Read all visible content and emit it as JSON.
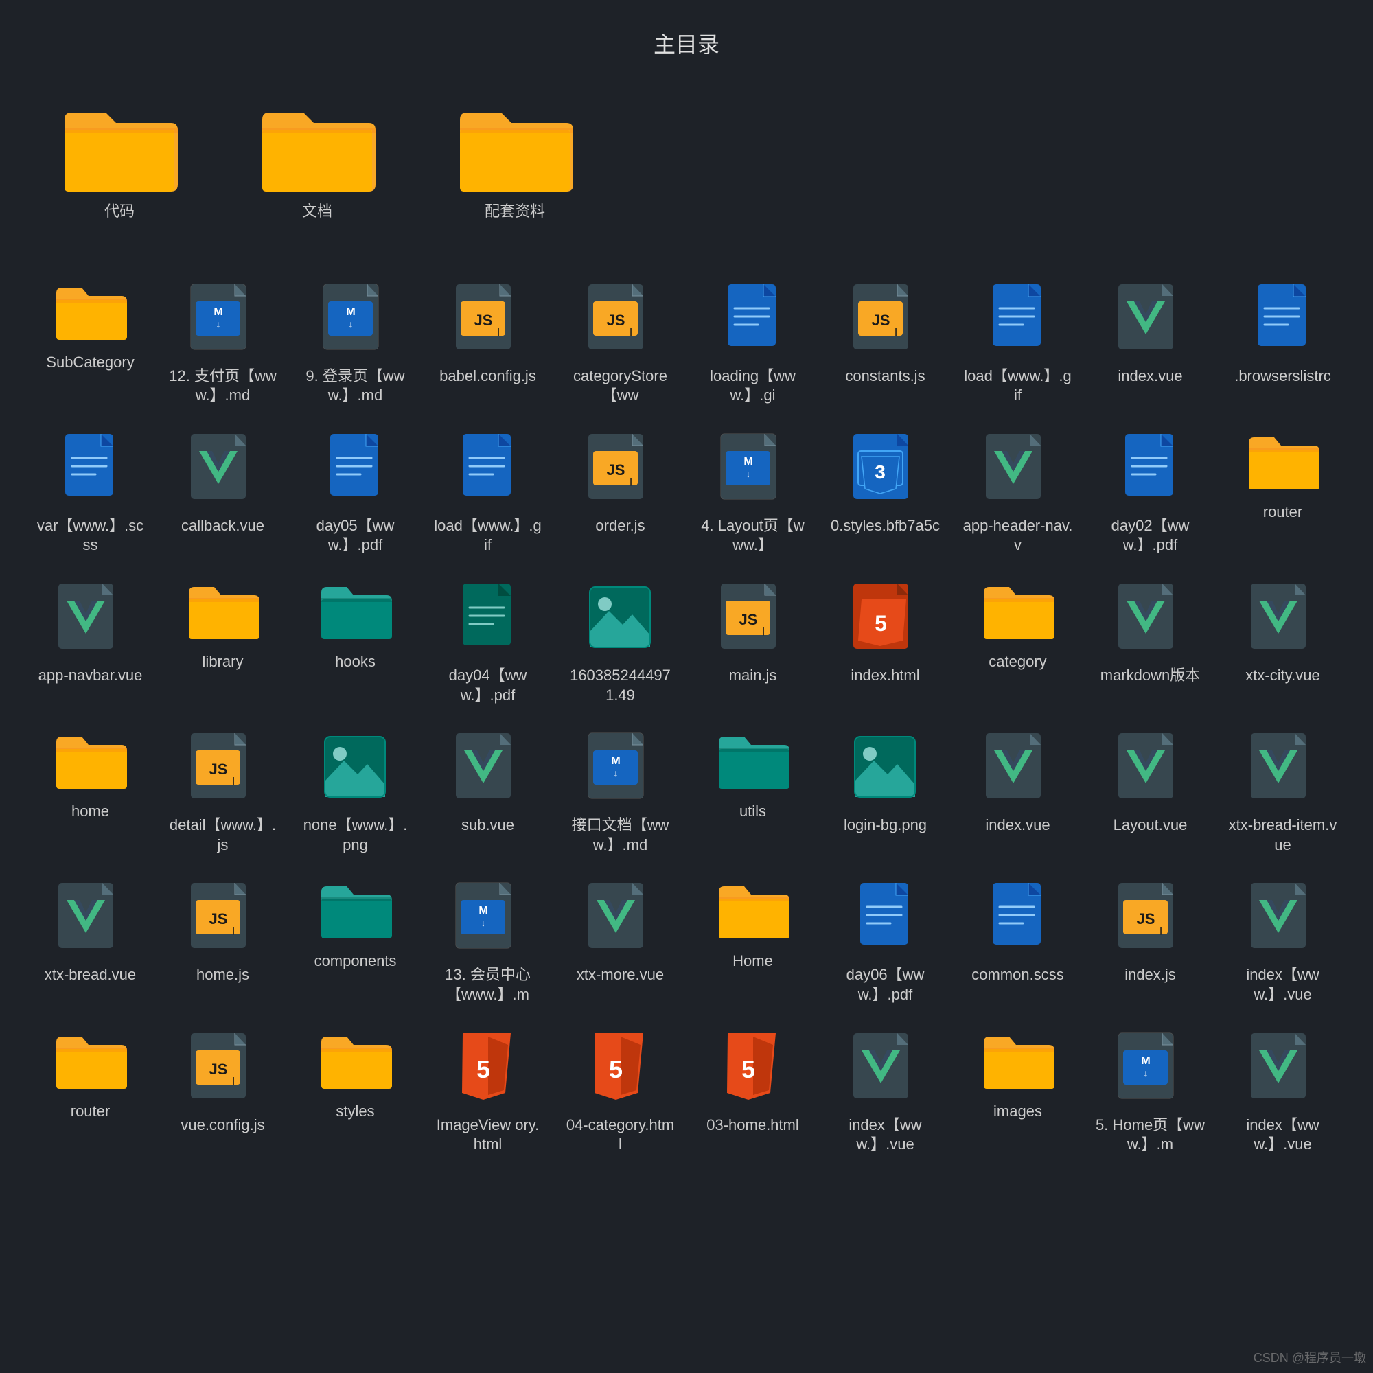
{
  "title": "主目录",
  "watermark": "CSDN @程序员一墩",
  "topFolders": [
    {
      "id": "daima",
      "label": "代码",
      "color": "yellow"
    },
    {
      "id": "wendang",
      "label": "文档",
      "color": "yellow"
    },
    {
      "id": "peitao",
      "label": "配套资料",
      "color": "yellow"
    }
  ],
  "items": [
    {
      "id": "subcategory",
      "type": "folder-yellow",
      "label": "SubCategory"
    },
    {
      "id": "md-12",
      "type": "md",
      "label": "12. 支付页【www.】.md"
    },
    {
      "id": "md-9",
      "type": "md",
      "label": "9. 登录页【www.】.md"
    },
    {
      "id": "babel-js",
      "type": "js",
      "label": "babel.config.js"
    },
    {
      "id": "category-store",
      "type": "js",
      "label": "categoryStore【ww"
    },
    {
      "id": "loading-gif",
      "type": "file-blue",
      "label": "loading【www.】.gi"
    },
    {
      "id": "constants-js",
      "type": "js",
      "label": "constants.js"
    },
    {
      "id": "load-gif",
      "type": "file-blue",
      "label": "load【www.】.gif"
    },
    {
      "id": "index-vue",
      "type": "vue",
      "label": "index.vue"
    },
    {
      "id": "browserslistrc",
      "type": "file-blue",
      "label": ".browserslistrc"
    },
    {
      "id": "var-scss",
      "type": "file-blue",
      "label": "var【www.】.scss"
    },
    {
      "id": "callback-vue",
      "type": "vue",
      "label": "callback.vue"
    },
    {
      "id": "day05-pdf",
      "type": "file-blue",
      "label": "day05【www.】.pdf"
    },
    {
      "id": "load-gif2",
      "type": "file-blue",
      "label": "load【www.】.gif"
    },
    {
      "id": "order-js",
      "type": "js",
      "label": "order.js"
    },
    {
      "id": "layout-md",
      "type": "md",
      "label": "4. Layout页【www.】"
    },
    {
      "id": "styles-css",
      "type": "css",
      "label": "0.styles.bfb7a5c"
    },
    {
      "id": "app-header-vue",
      "type": "vue",
      "label": "app-header-nav.v"
    },
    {
      "id": "day02-pdf",
      "type": "file-blue",
      "label": "day02【ww w.】.pdf"
    },
    {
      "id": "router",
      "type": "folder-yellow",
      "label": "router"
    },
    {
      "id": "app-navbar-vue",
      "type": "vue",
      "label": "app-navbar.vue"
    },
    {
      "id": "library",
      "type": "folder-yellow",
      "label": "library"
    },
    {
      "id": "hooks",
      "type": "folder-teal",
      "label": "hooks"
    },
    {
      "id": "day04-pdf",
      "type": "file-teal",
      "label": "day04【www.】.pdf"
    },
    {
      "id": "img-1604",
      "type": "img-teal",
      "label": "1603852444971.49"
    },
    {
      "id": "main-js",
      "type": "js",
      "label": "main.js"
    },
    {
      "id": "index-html",
      "type": "html5",
      "label": "index.html"
    },
    {
      "id": "category2",
      "type": "folder-yellow",
      "label": "category"
    },
    {
      "id": "markdown-vue",
      "type": "vue",
      "label": "markdown版本"
    },
    {
      "id": "xtx-city-vue",
      "type": "vue",
      "label": "xtx-city.vue"
    },
    {
      "id": "home",
      "type": "folder-yellow",
      "label": "home"
    },
    {
      "id": "detail-js",
      "type": "js",
      "label": "detail【www.】.js"
    },
    {
      "id": "none-png",
      "type": "img-teal",
      "label": "none【www.】.png"
    },
    {
      "id": "sub-vue",
      "type": "vue",
      "label": "sub.vue"
    },
    {
      "id": "api-md",
      "type": "md",
      "label": "接口文档【www.】.md"
    },
    {
      "id": "utils",
      "type": "folder-teal",
      "label": "utils"
    },
    {
      "id": "login-bg-png",
      "type": "img-teal",
      "label": "login-bg.png"
    },
    {
      "id": "index-vue2",
      "type": "vue",
      "label": "index.vue"
    },
    {
      "id": "layout-vue",
      "type": "vue",
      "label": "Layout.vue"
    },
    {
      "id": "xtx-bread-item-vue",
      "type": "vue",
      "label": "xtx-bread-item.vue"
    },
    {
      "id": "xtx-bread-vue",
      "type": "vue",
      "label": "xtx-bread.vue"
    },
    {
      "id": "home-js",
      "type": "js",
      "label": "home.js"
    },
    {
      "id": "components",
      "type": "folder-teal",
      "label": "components"
    },
    {
      "id": "md-13",
      "type": "md",
      "label": "13. 会员中心【www.】.m"
    },
    {
      "id": "xtx-more-vue",
      "type": "vue",
      "label": "xtx-more.vue"
    },
    {
      "id": "home-folder",
      "type": "folder-yellow",
      "label": "Home"
    },
    {
      "id": "day06-pdf",
      "type": "file-blue",
      "label": "day06【ww w.】.pdf"
    },
    {
      "id": "common-css",
      "type": "file-blue",
      "label": "common.scss"
    },
    {
      "id": "index-js",
      "type": "js",
      "label": "index.js"
    },
    {
      "id": "index-vue3",
      "type": "vue",
      "label": "index【ww w.】.vue"
    },
    {
      "id": "router2",
      "type": "folder-yellow",
      "label": "router"
    },
    {
      "id": "vue-config-js",
      "type": "js",
      "label": "vue.config.js"
    },
    {
      "id": "styles",
      "type": "folder-yellow",
      "label": "styles"
    },
    {
      "id": "imageview-html",
      "type": "html5-red",
      "label": "ImageView ory.html"
    },
    {
      "id": "04-cate-html",
      "type": "html5-red",
      "label": "04-category.html"
    },
    {
      "id": "03-home-html",
      "type": "html5-red",
      "label": "03-home.html"
    },
    {
      "id": "index-vue4",
      "type": "vue",
      "label": "index【ww w.】.vue"
    },
    {
      "id": "images",
      "type": "folder-yellow",
      "label": "images"
    },
    {
      "id": "home-md",
      "type": "md",
      "label": "5. Home页【www.】.m"
    },
    {
      "id": "index-vue5",
      "type": "vue",
      "label": "index【ww w.】.vue"
    }
  ]
}
